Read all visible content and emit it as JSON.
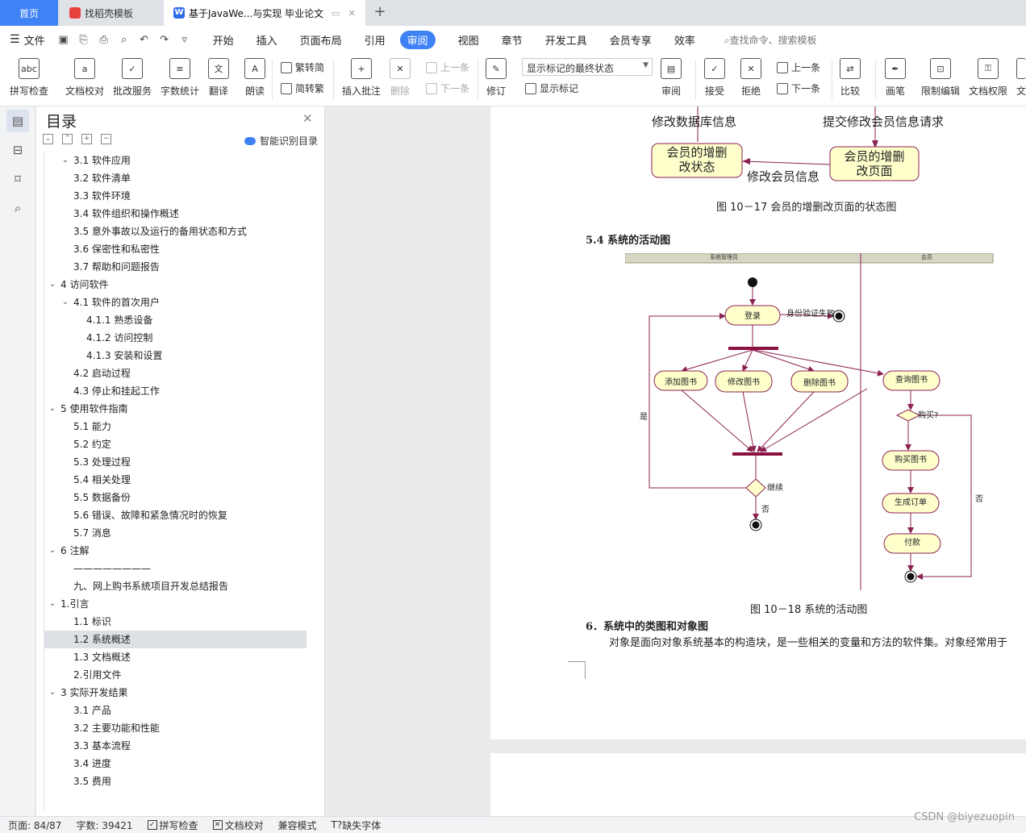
{
  "tabs": {
    "home": "首页",
    "template": "找稻壳模板",
    "document": "基于JavaWe...与实现 毕业论文"
  },
  "menu": {
    "file": "文件",
    "items": [
      "开始",
      "插入",
      "页面布局",
      "引用",
      "审阅",
      "视图",
      "章节",
      "开发工具",
      "会员专享",
      "效率"
    ],
    "active": "审阅",
    "search": "查找命令、搜索模板"
  },
  "ribbon": {
    "spell_check": "拼写检查",
    "doc_proof": "文档校对",
    "batch_service": "批改服务",
    "word_count": "字数统计",
    "translate": "翻译",
    "read_aloud": "朗读",
    "trad_to_simp": "繁转简",
    "simp_to_trad": "简转繁",
    "insert_comment": "插入批注",
    "delete": "删除",
    "prev_comment": "上一条",
    "next_comment": "下一条",
    "track_changes": "修订",
    "markup_state": "显示标记的最终状态",
    "show_markup": "显示标记",
    "review": "审阅",
    "accept": "接受",
    "reject": "拒绝",
    "prev_change": "上一条",
    "next_change": "下一条",
    "compare": "比较",
    "pen": "画笔",
    "restrict_edit": "限制编辑",
    "doc_permission": "文档权限",
    "cut_text": "文"
  },
  "toc": {
    "title": "目录",
    "smart": "智能识别目录",
    "items": [
      {
        "label": "3.1 软件应用",
        "level": 1,
        "chev": true
      },
      {
        "label": "3.2 软件清单",
        "level": 2
      },
      {
        "label": "3.3 软件环境",
        "level": 2
      },
      {
        "label": "3.4 软件组织和操作概述",
        "level": 2
      },
      {
        "label": "3.5 意外事故以及运行的备用状态和方式",
        "level": 2
      },
      {
        "label": "3.6 保密性和私密性",
        "level": 2
      },
      {
        "label": "3.7 帮助和问题报告",
        "level": 2
      },
      {
        "label": "4 访问软件",
        "level": 0,
        "chev": true
      },
      {
        "label": "4.1 软件的首次用户",
        "level": 1,
        "chev": true
      },
      {
        "label": "4.1.1 熟悉设备",
        "level": 3
      },
      {
        "label": "4.1.2 访问控制",
        "level": 3
      },
      {
        "label": "4.1.3 安装和设置",
        "level": 3
      },
      {
        "label": "4.2 启动过程",
        "level": 2
      },
      {
        "label": "4.3 停止和挂起工作",
        "level": 2
      },
      {
        "label": "5 使用软件指南",
        "level": 0,
        "chev": true
      },
      {
        "label": "5.1 能力",
        "level": 2
      },
      {
        "label": "5.2 约定",
        "level": 2
      },
      {
        "label": "5.3 处理过程",
        "level": 2
      },
      {
        "label": "5.4 相关处理",
        "level": 2
      },
      {
        "label": "5.5 数据备份",
        "level": 2
      },
      {
        "label": "5.6 错误、故障和紧急情况时的恢复",
        "level": 2
      },
      {
        "label": "5.7 消息",
        "level": 2
      },
      {
        "label": "6 注解",
        "level": 0,
        "chev": true
      },
      {
        "label": "————————",
        "level": 2
      },
      {
        "label": "九、网上购书系统项目开发总结报告",
        "level": 2
      },
      {
        "label": "1.引言",
        "level": 0,
        "chev": true
      },
      {
        "label": "1.1 标识",
        "level": 2
      },
      {
        "label": "1.2 系统概述",
        "level": 1,
        "selected": true
      },
      {
        "label": "1.3 文档概述",
        "level": 1
      },
      {
        "label": "2.引用文件",
        "level": 1
      },
      {
        "label": "3 实际开发结果",
        "level": 0,
        "chev": true
      },
      {
        "label": "3.1 产品",
        "level": 2
      },
      {
        "label": "3.2 主要功能和性能",
        "level": 2
      },
      {
        "label": "3.3 基本流程",
        "level": 2
      },
      {
        "label": "3.4 进度",
        "level": 2
      },
      {
        "label": "3.5 费用",
        "level": 2
      }
    ]
  },
  "document": {
    "state_diagram": {
      "label_modify_db": "修改数据库信息",
      "label_submit": "提交修改会员信息请求",
      "state_left": [
        "会员的增删",
        "改状态"
      ],
      "state_right": [
        "会员的增删",
        "改页面"
      ],
      "label_modify_member": "修改会员信息"
    },
    "caption_state": "图 10－17 会员的增删改页面的状态图",
    "heading_54": "5.4  系统的活动图",
    "activity": {
      "lane_admin": "系统管理员",
      "lane_member": "会员",
      "login": "登录",
      "auth_fail": "身份验证失败",
      "add_book": "添加图书",
      "edit_book": "修改图书",
      "delete_book": "删除图书",
      "query_book": "查询图书",
      "buy_q": "购买?",
      "buy_book": "购买图书",
      "gen_order": "生成订单",
      "pay": "付款",
      "yes": "是",
      "no": "否",
      "continue": "继续",
      "no2": "否"
    },
    "caption_activity": "图 10－18 系统的活动图",
    "heading_6": "6．系统中的类图和对象图",
    "body_text": "对象是面向对象系统基本的构造块，是一些相关的变量和方法的软件集。对象经常用于"
  },
  "status": {
    "page": "页面: 84/87",
    "words": "字数: 39421",
    "spell": "拼写检查",
    "proof": "文档校对",
    "compat": "兼容模式",
    "missing_font": "缺失字体"
  },
  "watermark": "CSDN @biyezuopin"
}
